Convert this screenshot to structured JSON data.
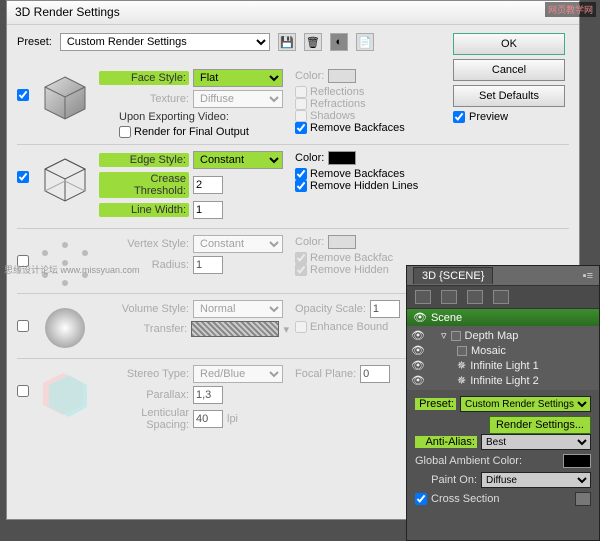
{
  "dialog": {
    "title": "3D Render Settings",
    "preset_label": "Preset:",
    "preset_value": "Custom Render Settings",
    "buttons": {
      "ok": "OK",
      "cancel": "Cancel",
      "defaults": "Set Defaults"
    },
    "preview": "Preview"
  },
  "face": {
    "style_label": "Face Style:",
    "style_value": "Flat",
    "texture_label": "Texture:",
    "texture_value": "Diffuse",
    "export_label": "Upon Exporting Video:",
    "final_output": "Render for Final Output",
    "color_label": "Color:",
    "reflections": "Reflections",
    "refractions": "Refractions",
    "shadows": "Shadows",
    "remove_backfaces": "Remove Backfaces"
  },
  "edge": {
    "style_label": "Edge Style:",
    "style_value": "Constant",
    "crease_label": "Crease Threshold:",
    "crease_value": "2",
    "width_label": "Line Width:",
    "width_value": "1",
    "color_label": "Color:",
    "remove_backfaces": "Remove Backfaces",
    "remove_hidden": "Remove Hidden Lines"
  },
  "vertex": {
    "style_label": "Vertex Style:",
    "style_value": "Constant",
    "radius_label": "Radius:",
    "radius_value": "1",
    "color_label": "Color:",
    "remove_backfaces": "Remove Backfac",
    "remove_hidden": "Remove Hidden"
  },
  "volume": {
    "style_label": "Volume Style:",
    "style_value": "Normal",
    "transfer_label": "Transfer:",
    "opacity_label": "Opacity Scale:",
    "opacity_value": "1",
    "enhance": "Enhance Bound"
  },
  "stereo": {
    "type_label": "Stereo Type:",
    "type_value": "Red/Blue",
    "parallax_label": "Parallax:",
    "parallax_value": "1,3",
    "spacing_label": "Lenticular Spacing:",
    "spacing_value": "40",
    "lpi": "lpi",
    "focal_label": "Focal Plane:",
    "focal_value": "0"
  },
  "panel": {
    "tab": "3D {SCENE}",
    "scene": "Scene",
    "tree": [
      "Depth Map",
      "Mosaic",
      "Infinite Light 1",
      "Infinite Light 2"
    ],
    "preset_label": "Preset:",
    "preset_value": "Custom Render Settings",
    "render_btn": "Render Settings...",
    "aa_label": "Anti-Alias:",
    "aa_value": "Best",
    "global_label": "Global Ambient Color:",
    "paint_label": "Paint On:",
    "paint_value": "Diffuse",
    "cross_label": "Cross Section"
  },
  "watermark": "网页教学网",
  "watermark2": "思缘设计论坛  www.missyuan.com"
}
